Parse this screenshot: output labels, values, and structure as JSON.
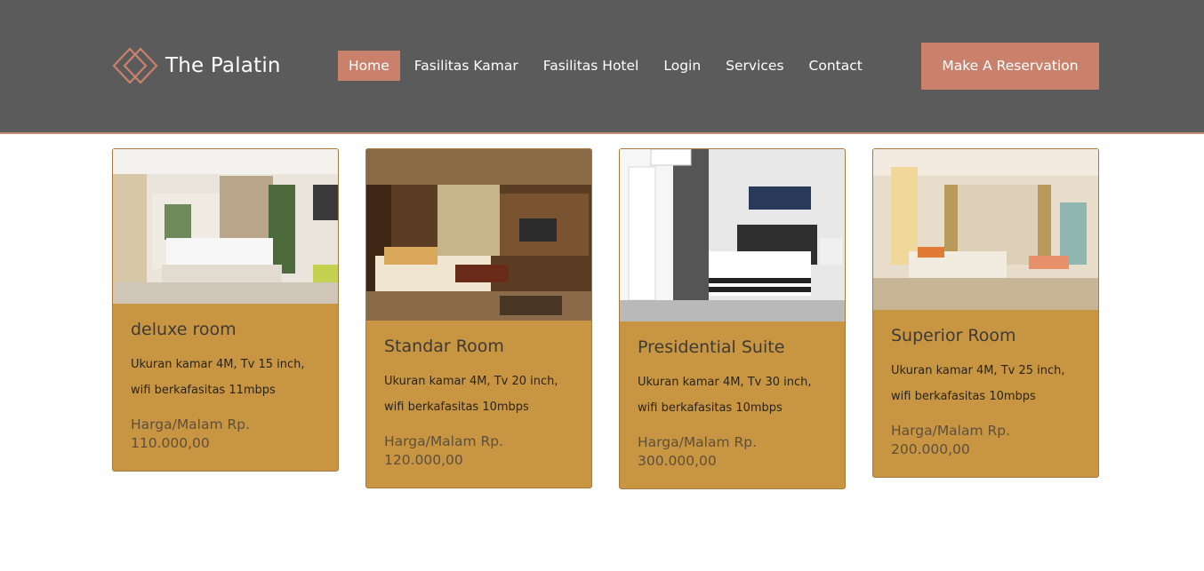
{
  "brand": {
    "name": "The Palatin",
    "logo_icon": "diamond-logo-icon"
  },
  "nav": {
    "items": [
      {
        "label": "Home",
        "active": true
      },
      {
        "label": "Fasilitas Kamar",
        "active": false
      },
      {
        "label": "Fasilitas Hotel",
        "active": false
      },
      {
        "label": "Login",
        "active": false
      },
      {
        "label": "Services",
        "active": false
      },
      {
        "label": "Contact",
        "active": false
      }
    ]
  },
  "header": {
    "cta_label": "Make A Reservation"
  },
  "rooms": [
    {
      "title": "deluxe room",
      "desc_line1": "Ukuran kamar 4M, Tv 15 inch,",
      "desc_line2": "wifi berkafasitas 11mbps",
      "price_label": "Harga/Malam Rp.",
      "price_value": "110.000,00"
    },
    {
      "title": "Standar Room",
      "desc_line1": "Ukuran kamar 4M, Tv 20 inch,",
      "desc_line2": "wifi berkafasitas 10mbps",
      "price_label": "Harga/Malam Rp.",
      "price_value": "120.000,00"
    },
    {
      "title": "Presidential Suite",
      "desc_line1": "Ukuran kamar 4M, Tv 30 inch,",
      "desc_line2": "wifi berkafasitas 10mbps",
      "price_label": "Harga/Malam Rp.",
      "price_value": "300.000,00"
    },
    {
      "title": "Superior Room",
      "desc_line1": "Ukuran kamar 4M, Tv 25 inch,",
      "desc_line2": "wifi berkafasitas 10mbps",
      "price_label": "Harga/Malam Rp.",
      "price_value": "200.000,00"
    }
  ],
  "colors": {
    "header_bg": "#5b5b5b",
    "accent": "#c9816c",
    "card_bg": "#c89642"
  }
}
